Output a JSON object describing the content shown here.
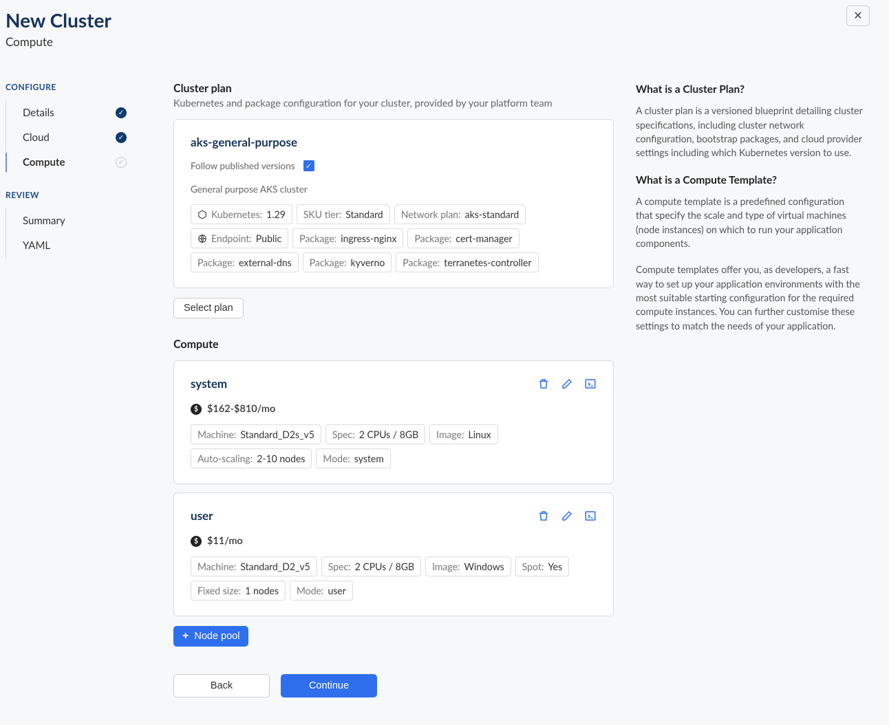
{
  "header": {
    "title": "New Cluster",
    "subtitle": "Compute"
  },
  "sidebar": {
    "configure_label": "CONFIGURE",
    "review_label": "REVIEW",
    "configure_items": [
      {
        "label": "Details",
        "state": "done"
      },
      {
        "label": "Cloud",
        "state": "done"
      },
      {
        "label": "Compute",
        "state": "pending",
        "active": true
      }
    ],
    "review_items": [
      {
        "label": "Summary"
      },
      {
        "label": "YAML"
      }
    ]
  },
  "plan": {
    "section_title": "Cluster plan",
    "section_subtitle": "Kubernetes and package configuration for your cluster, provided by your platform team",
    "name": "aks-general-purpose",
    "follow_label": "Follow published versions",
    "description": "General purpose AKS cluster",
    "tags": {
      "k8s_label": "Kubernetes: ",
      "k8s_value": "1.29",
      "sku_label": "SKU tier: ",
      "sku_value": "Standard",
      "net_label": "Network plan: ",
      "net_value": "aks-standard",
      "ep_label": "Endpoint: ",
      "ep_value": "Public",
      "pkg_label": "Package: ",
      "pkg1": "ingress-nginx",
      "pkg2": "cert-manager",
      "pkg3": "external-dns",
      "pkg4": "kyverno",
      "pkg5": "terranetes-controller"
    },
    "select_plan_label": "Select plan"
  },
  "compute": {
    "section_title": "Compute",
    "pools": [
      {
        "name": "system",
        "price": "$162-$810/mo",
        "tags": [
          {
            "label": "Machine: ",
            "value": "Standard_D2s_v5"
          },
          {
            "label": "Spec: ",
            "value": "2 CPUs / 8GB"
          },
          {
            "label": "Image: ",
            "value": "Linux"
          },
          {
            "label": "Auto-scaling: ",
            "value": "2-10 nodes"
          },
          {
            "label": "Mode: ",
            "value": "system"
          }
        ]
      },
      {
        "name": "user",
        "price": "$11/mo",
        "tags": [
          {
            "label": "Machine: ",
            "value": "Standard_D2_v5"
          },
          {
            "label": "Spec: ",
            "value": "2 CPUs / 8GB"
          },
          {
            "label": "Image: ",
            "value": "Windows"
          },
          {
            "label": "Spot: ",
            "value": "Yes"
          },
          {
            "label": "Fixed size: ",
            "value": "1 nodes"
          },
          {
            "label": "Mode: ",
            "value": "user"
          }
        ]
      }
    ],
    "add_pool_label": "Node pool"
  },
  "footer": {
    "back": "Back",
    "continue": "Continue"
  },
  "info": {
    "h1": "What is a Cluster Plan?",
    "p1": "A cluster plan is a versioned blueprint detailing cluster specifications, including cluster network configuration, bootstrap packages, and cloud provider settings including which Kubernetes version to use.",
    "h2": "What is a Compute Template?",
    "p2": "A compute template is a predefined configuration that specify the scale and type of virtual machines (node instances) on which to run your application components.",
    "p3": "Compute templates offer you, as developers, a fast way to set up your application environments with the most suitable starting configuration for the required compute instances. You can further customise these settings to match the needs of your application."
  }
}
